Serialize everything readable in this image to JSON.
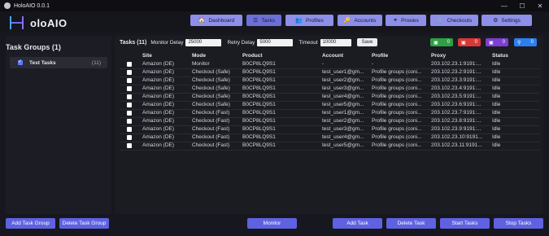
{
  "window": {
    "title": "HoloAIO 0.0.1",
    "controls": [
      "—",
      "☐",
      "✕"
    ]
  },
  "brand": {
    "name": "oloAIO"
  },
  "nav": [
    {
      "label": "Dashboard",
      "icon": "🏠"
    },
    {
      "label": "Tasks",
      "icon": "☰"
    },
    {
      "label": "Profiles",
      "icon": "👥"
    },
    {
      "label": "Accounts",
      "icon": "🔑"
    },
    {
      "label": "Proxies",
      "icon": "⚭"
    },
    {
      "label": "Checkouts",
      "icon": "🛒"
    },
    {
      "label": "Settings",
      "icon": "⚙"
    }
  ],
  "sidebar": {
    "title": "Task Groups (1)",
    "groups": [
      {
        "name": "Test Tasks",
        "count": "(11)"
      }
    ]
  },
  "toolbar": {
    "title": "Tasks (11)",
    "monitor_label": "Monitor Delay",
    "monitor_value": "25000",
    "retry_label": "Retry Delay",
    "retry_value": "5000",
    "timeout_label": "Timeout",
    "timeout_value": "10000",
    "save_label": "Save"
  },
  "stats": [
    {
      "icon": "cart-icon",
      "value": "0",
      "color": "#2ea043"
    },
    {
      "icon": "cart-icon",
      "value": "0",
      "color": "#d93737"
    },
    {
      "icon": "cart-icon",
      "value": "0",
      "color": "#7b3fd1"
    },
    {
      "icon": "bike-icon",
      "value": "0",
      "color": "#2d7ff0"
    }
  ],
  "table": {
    "headers": [
      "Site",
      "Mode",
      "Product",
      "Account",
      "Profile",
      "Proxy",
      "Status"
    ],
    "rows": [
      [
        "Amazon (DE)",
        "Monitor",
        "B0CP8LQ9S1",
        "-",
        "-",
        "203.102.23.1:9191:...",
        "Idle"
      ],
      [
        "Amazon (DE)",
        "Checkout (Safe)",
        "B0CP8LQ9S1",
        "test_user1@gm...",
        "Profile groups (coni...",
        "203.102.23.2:9191:...",
        "Idle"
      ],
      [
        "Amazon (DE)",
        "Checkout (Safe)",
        "B0CP8LQ9S1",
        "test_user2@gm...",
        "Profile groups (coni...",
        "203.102.23.3:9191:...",
        "Idle"
      ],
      [
        "Amazon (DE)",
        "Checkout (Safe)",
        "B0CP8LQ9S1",
        "test_user3@gm...",
        "Profile groups (coni...",
        "203.102.23.4:9191:...",
        "Idle"
      ],
      [
        "Amazon (DE)",
        "Checkout (Safe)",
        "B0CP8LQ9S1",
        "test_user4@gm...",
        "Profile groups (coni...",
        "203.102.23.5:9191:...",
        "Idle"
      ],
      [
        "Amazon (DE)",
        "Checkout (Safe)",
        "B0CP8LQ9S1",
        "test_user5@gm...",
        "Profile groups (coni...",
        "203.102.23.6:9191:...",
        "Idle"
      ],
      [
        "Amazon (DE)",
        "Checkout (Fast)",
        "B0CP8LQ9S1",
        "test_user1@gm...",
        "Profile groups (coni...",
        "203.102.23.7:9191:...",
        "Idle"
      ],
      [
        "Amazon (DE)",
        "Checkout (Fast)",
        "B0CP8LQ9S1",
        "test_user2@gm...",
        "Profile groups (coni...",
        "203.102.23.8:9191:...",
        "Idle"
      ],
      [
        "Amazon (DE)",
        "Checkout (Fast)",
        "B0CP8LQ9S1",
        "test_user3@gm...",
        "Profile groups (coni...",
        "203.102.23.9:9191:...",
        "Idle"
      ],
      [
        "Amazon (DE)",
        "Checkout (Fast)",
        "B0CP8LQ9S1",
        "test_user4@gm...",
        "Profile groups (coni...",
        "203.102.23.10:9191...",
        "Idle"
      ],
      [
        "Amazon (DE)",
        "Checkout (Fast)",
        "B0CP8LQ9S1",
        "test_user5@gm...",
        "Profile groups (coni...",
        "203.102.23.11:9191...",
        "Idle"
      ]
    ]
  },
  "buttons": {
    "add_group": "Add Task Group",
    "delete_group": "Delete Task Group",
    "monitor": "Monitor",
    "add_task": "Add Task",
    "delete_task": "Delete Task",
    "start_tasks": "Start Tasks",
    "stop_tasks": "Stop Tasks"
  }
}
